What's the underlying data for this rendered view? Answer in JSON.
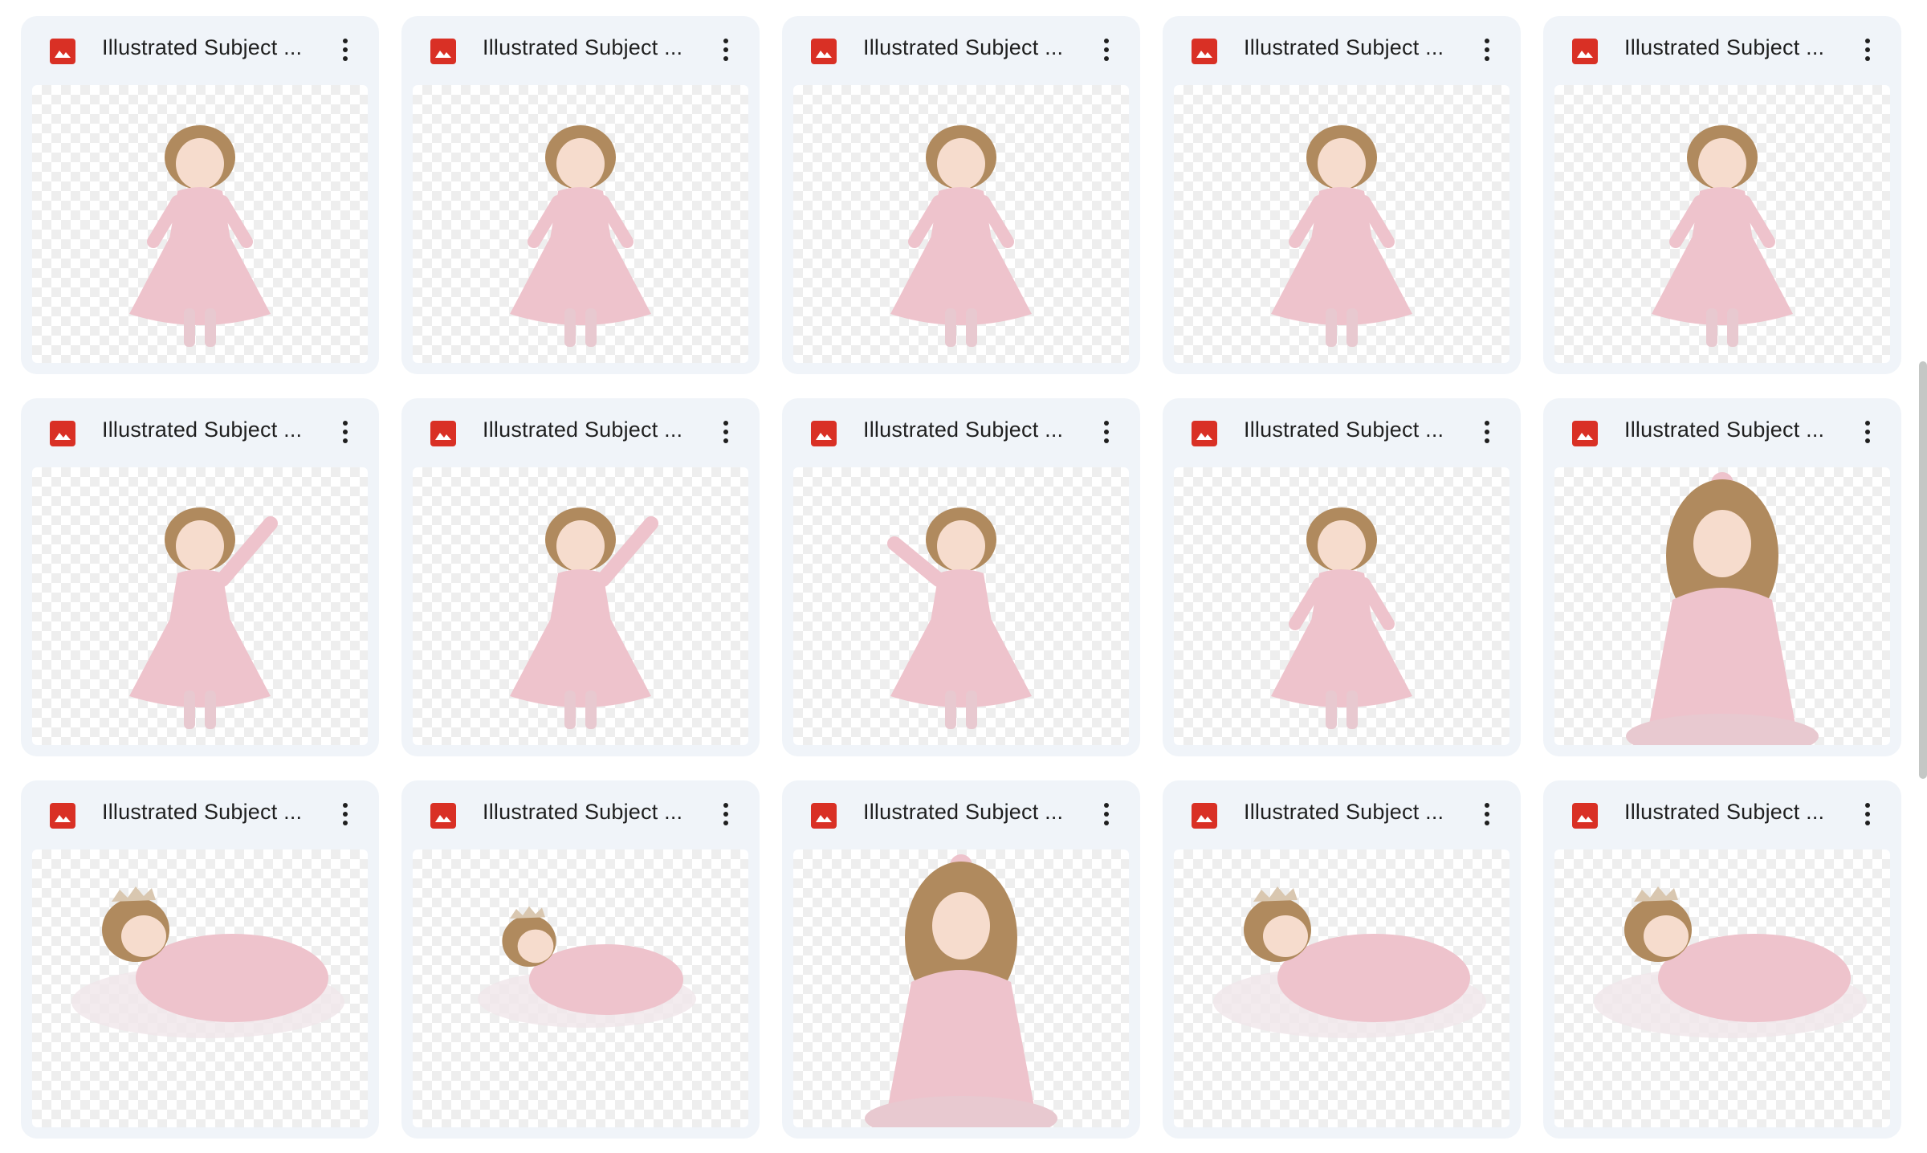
{
  "files": [
    {
      "name": "Illustrated Subject ...",
      "thumb": "standing"
    },
    {
      "name": "Illustrated Subject ...",
      "thumb": "standing"
    },
    {
      "name": "Illustrated Subject ...",
      "thumb": "standing"
    },
    {
      "name": "Illustrated Subject ...",
      "thumb": "standing"
    },
    {
      "name": "Illustrated Subject ...",
      "thumb": "standing"
    },
    {
      "name": "Illustrated Subject ...",
      "thumb": "reaching"
    },
    {
      "name": "Illustrated Subject ...",
      "thumb": "reaching"
    },
    {
      "name": "Illustrated Subject ...",
      "thumb": "dancing"
    },
    {
      "name": "Illustrated Subject ...",
      "thumb": "standing"
    },
    {
      "name": "Illustrated Subject ...",
      "thumb": "sitting-hat"
    },
    {
      "name": "Illustrated Subject ...",
      "thumb": "lying"
    },
    {
      "name": "Illustrated Subject ...",
      "thumb": "lying-far"
    },
    {
      "name": "Illustrated Subject ...",
      "thumb": "sitting-hat"
    },
    {
      "name": "Illustrated Subject ...",
      "thumb": "lying"
    },
    {
      "name": "Illustrated Subject ...",
      "thumb": "lying"
    }
  ],
  "icons": {
    "file_type": "image-file-icon",
    "more": "more-vert-icon"
  },
  "colors": {
    "card_bg": "#f0f4f9",
    "image_icon": "#d93025",
    "dress": "#eec3cc",
    "hair": "#b08a5e",
    "skin": "#f6dccd"
  }
}
